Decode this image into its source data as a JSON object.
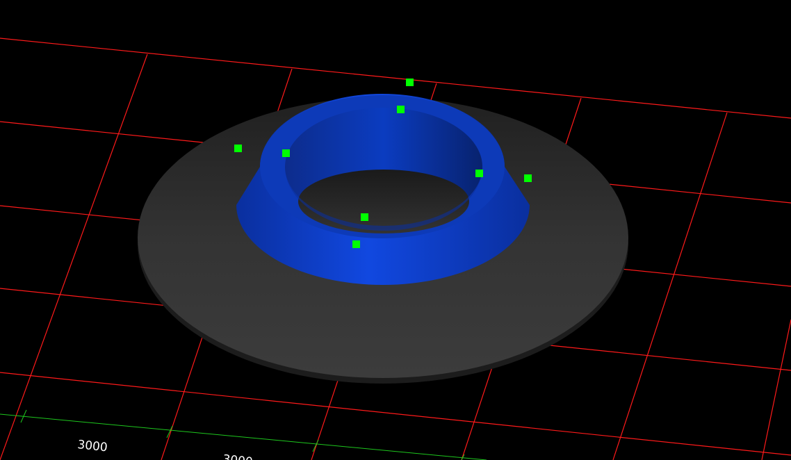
{
  "viewport": {
    "background": "#000000",
    "grid_color": "#ff1a1a",
    "dimension_line_color": "#1ec81e",
    "dimension_labels": [
      "3000",
      "3000"
    ]
  },
  "model": {
    "base_disk_color": "#3a3a3a",
    "cone_color": "#1040d8",
    "hole_color": "#2a2a2a",
    "control_point_color": "#00ff00",
    "control_point_count": 8
  }
}
